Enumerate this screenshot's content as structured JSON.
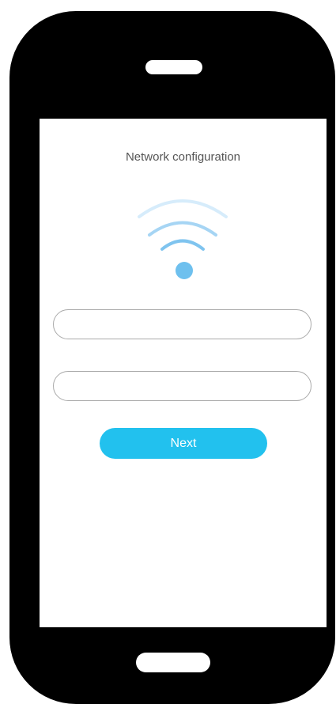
{
  "screen": {
    "title": "Network configuration",
    "icon": "wifi-icon",
    "fields": [
      {
        "value": "",
        "placeholder": ""
      },
      {
        "value": "",
        "placeholder": ""
      }
    ],
    "next_label": "Next"
  },
  "colors": {
    "phone_body": "#000000",
    "accent": "#22c1ee",
    "wifi_dot": "#6ec0ee",
    "wifi_arc_outer": "#d6ecfb",
    "wifi_arc_middle": "#a6d5f4",
    "wifi_arc_inner": "#7fc4ef"
  }
}
